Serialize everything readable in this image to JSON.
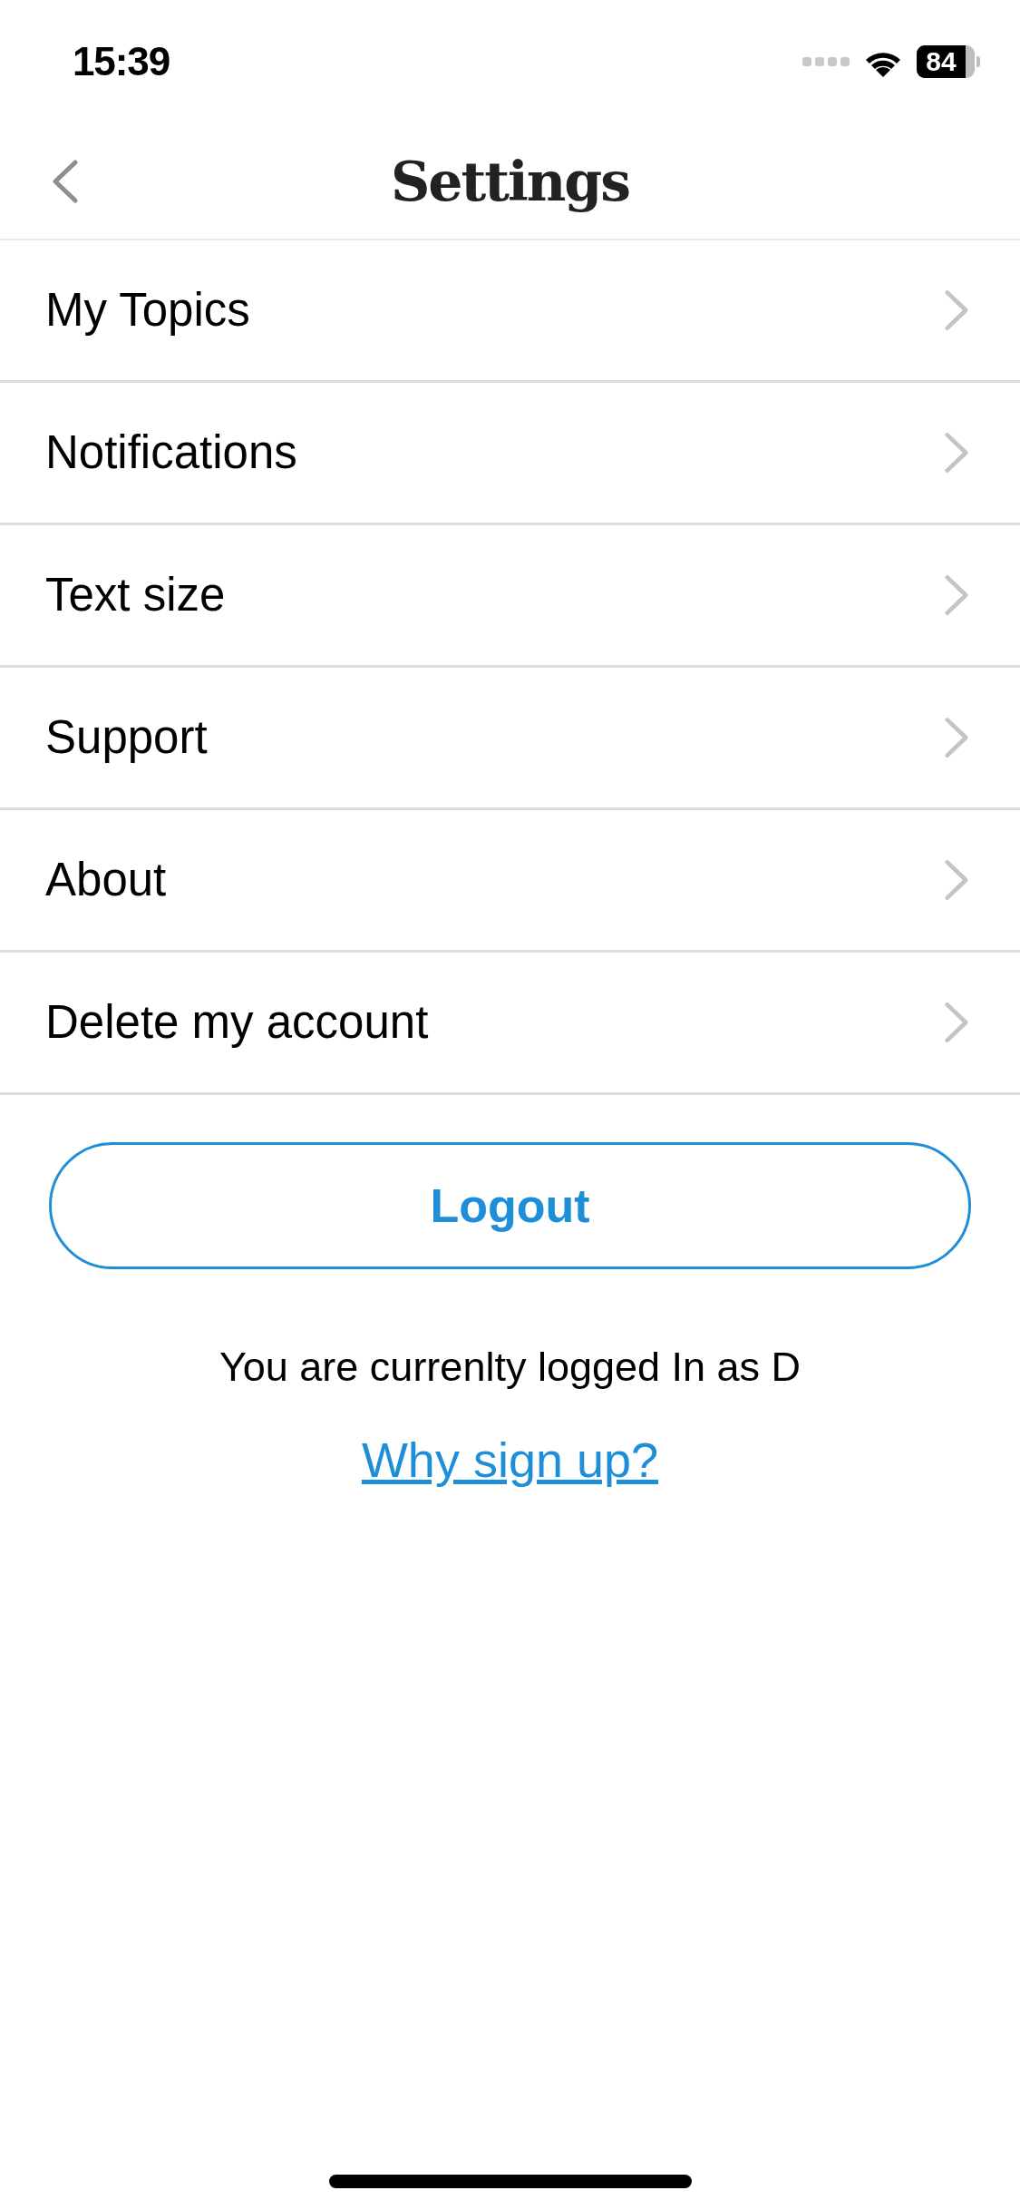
{
  "status_bar": {
    "time": "15:39",
    "battery": "84"
  },
  "header": {
    "title": "Settings"
  },
  "menu_items": [
    {
      "label": "My Topics"
    },
    {
      "label": "Notifications"
    },
    {
      "label": "Text size"
    },
    {
      "label": "Support"
    },
    {
      "label": "About"
    },
    {
      "label": "Delete my account"
    }
  ],
  "logout_button": {
    "label": "Logout"
  },
  "login_status": "You are currenlty logged In as D",
  "signup_link": "Why sign up?"
}
